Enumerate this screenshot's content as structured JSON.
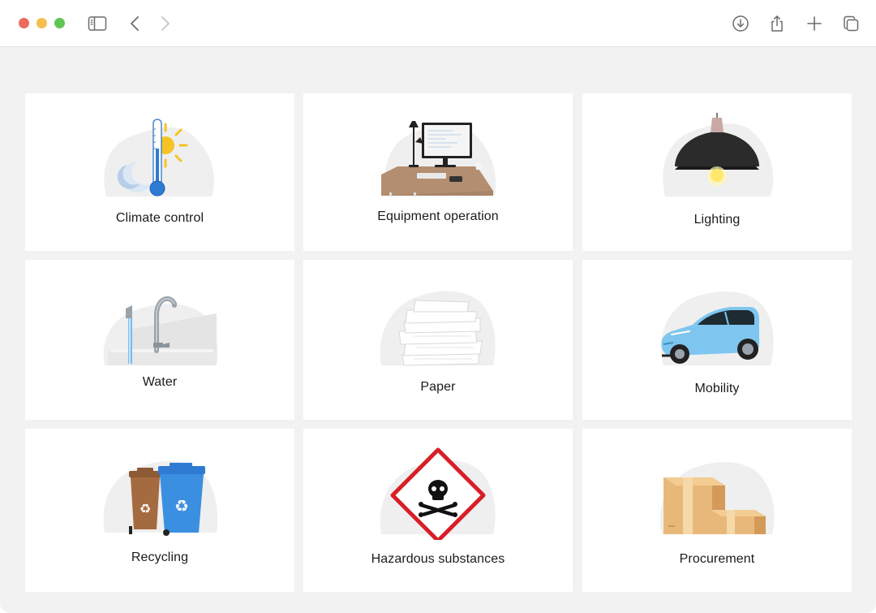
{
  "toolbar": {
    "icons": [
      "sidebar-icon",
      "back-icon",
      "forward-icon",
      "download-icon",
      "share-icon",
      "new-tab-icon",
      "tabs-overview-icon"
    ]
  },
  "cards": [
    {
      "label": "Climate control",
      "icon": "thermometer-sun-moon"
    },
    {
      "label": "Equipment operation",
      "icon": "desk-computer"
    },
    {
      "label": "Lighting",
      "icon": "pendant-lamp"
    },
    {
      "label": "Water",
      "icon": "faucet"
    },
    {
      "label": "Paper",
      "icon": "paper-stack"
    },
    {
      "label": "Mobility",
      "icon": "electric-car"
    },
    {
      "label": "Recycling",
      "icon": "recycling-bins"
    },
    {
      "label": "Hazardous substances",
      "icon": "skull-hazard-sign"
    },
    {
      "label": "Procurement",
      "icon": "cardboard-boxes"
    }
  ],
  "colors": {
    "background": "#f2f2f2",
    "card": "#ffffff",
    "blob": "#efefef",
    "text": "#1b1b1b"
  }
}
